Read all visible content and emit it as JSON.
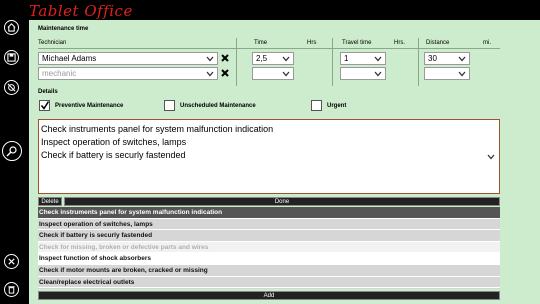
{
  "app": {
    "title": "Tablet Office"
  },
  "sidebar": [
    {
      "name": "home-icon"
    },
    {
      "name": "save-icon"
    },
    {
      "name": "disc-off-icon"
    },
    {
      "name": "sign-icon"
    },
    {
      "name": "close-icon"
    },
    {
      "name": "delete-icon"
    }
  ],
  "maintenance_time": {
    "section_label": "Maintenance time",
    "headers": {
      "technician": "Technician",
      "time": "Time",
      "time_unit": "Hrs",
      "travel_time": "Travel time",
      "travel_unit": "Hrs.",
      "distance": "Distance",
      "distance_unit": "mi."
    },
    "rows": [
      {
        "technician": "Michael Adams",
        "technician_placeholder": false,
        "time": "2,5",
        "travel": "1",
        "distance": "30"
      },
      {
        "technician": "mechanic",
        "technician_placeholder": true,
        "time": "",
        "travel": "",
        "distance": ""
      }
    ]
  },
  "details": {
    "section_label": "Details",
    "checkboxes": [
      {
        "label": "Preventive Maintenance",
        "checked": true
      },
      {
        "label": "Unscheduled Maintenance",
        "checked": false
      },
      {
        "label": "Urgent",
        "checked": false
      }
    ],
    "notes_lines": [
      "Check instruments panel for system malfunction indication",
      "Inspect operation of switches, lamps",
      "Check if battery is securly fastended"
    ],
    "delete_label": "Delete",
    "done_label": "Done"
  },
  "task_list": {
    "items": [
      {
        "text": "Check instruments panel for system malfunction indication",
        "style": "dark"
      },
      {
        "text": "Inspect operation of switches, lamps",
        "style": "normal"
      },
      {
        "text": "Check if battery is securly fastended",
        "style": "normal"
      },
      {
        "text": "Check for missing, broken or defective parts and wires",
        "style": "light"
      },
      {
        "text": "Inspect function of shock absorbers",
        "style": "sel"
      },
      {
        "text": "Check if motor mounts are broken, cracked or missing",
        "style": "normal"
      },
      {
        "text": "Clean/replace electrical outlets",
        "style": "normal"
      }
    ],
    "add_label": "Add"
  }
}
